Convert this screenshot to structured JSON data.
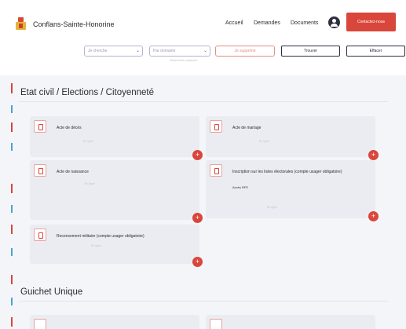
{
  "header": {
    "brand": "Conflans-Sainte-Honorine",
    "nav": {
      "accueil": "Accueil",
      "demandes": "Demandes",
      "documents": "Documents"
    },
    "cta_label": "Contactez-nous"
  },
  "search": {
    "field1_placeholder": "Je cherche",
    "field2_placeholder": "Par domaine",
    "clear_label": "Je supprime",
    "search_label": "Trouver",
    "reset_label": "Effacer",
    "hint": "Recherche avancée"
  },
  "sections": [
    {
      "title": "Etat civil / Elections / Citoyenneté",
      "cards": [
        {
          "title": "Acte de décès",
          "meta": "En ligne"
        },
        {
          "title": "Acte de mariage",
          "meta": "En ligne"
        },
        {
          "title": "Acte de naissance",
          "meta": "En ligne"
        },
        {
          "title": "Inscription sur les listes électorales (compte usager obligatoire)",
          "subtitle": "Accès RFE",
          "meta": "En ligne"
        },
        {
          "title": "Recensement militaire (compte usager obligatoire)",
          "meta": "En ligne"
        }
      ]
    },
    {
      "title": "Guichet Unique"
    }
  ],
  "colors": {
    "accent": "#d9463b",
    "timeline_red": "#d9463b",
    "timeline_blue": "#4aa3cf",
    "card_bg": "#ebecf1",
    "page_bg": "#f4f5f9"
  },
  "icons": {
    "add": "+"
  }
}
